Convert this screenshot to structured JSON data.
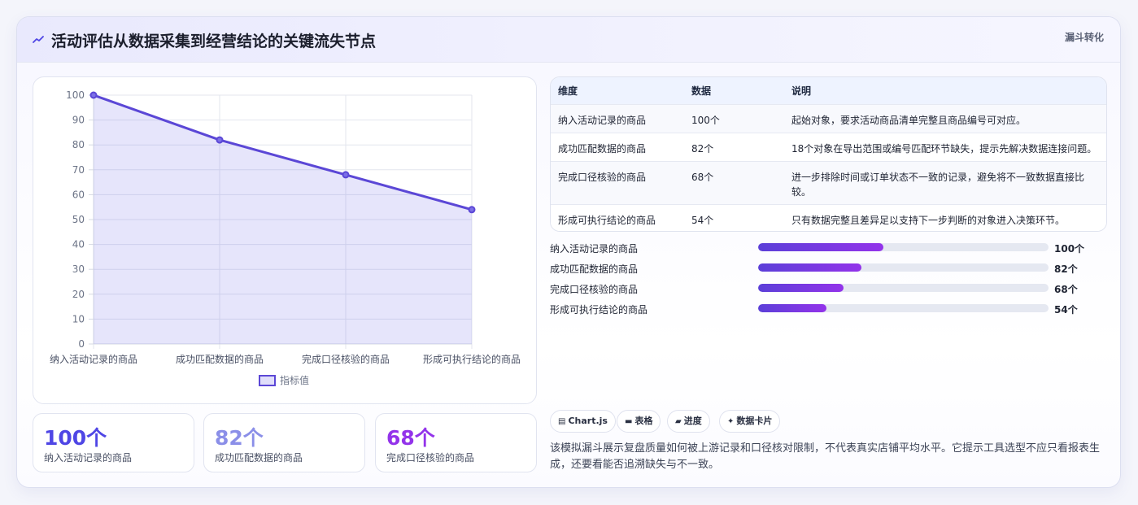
{
  "header": {
    "icon": "chart-trend-icon",
    "title": "活动评估从数据采集到经营结论的关键流失节点",
    "tag": "漏斗转化"
  },
  "colors": {
    "accent": "#5b47d6",
    "stat1": "#4f46e5",
    "stat2": "#8b8fe8",
    "stat3": "#9333ea"
  },
  "chart_data": {
    "type": "area",
    "categories": [
      "纳入活动记录的商品",
      "成功匹配数据的商品",
      "完成口径核验的商品",
      "形成可执行结论的商品"
    ],
    "series": [
      {
        "name": "指标值",
        "values": [
          100,
          82,
          68,
          54
        ]
      }
    ],
    "ylim": [
      0,
      100
    ],
    "yticks": [
      0,
      10,
      20,
      30,
      40,
      50,
      60,
      70,
      80,
      90,
      100
    ],
    "grid": true,
    "legend": "bottom"
  },
  "stats": [
    {
      "value": "100个",
      "label": "纳入活动记录的商品"
    },
    {
      "value": "82个",
      "label": "成功匹配数据的商品"
    },
    {
      "value": "68个",
      "label": "完成口径核验的商品"
    }
  ],
  "table": {
    "headers": [
      "维度",
      "数据",
      "说明"
    ],
    "rows": [
      [
        "纳入活动记录的商品",
        "100个",
        "起始对象，要求活动商品清单完整且商品编号可对应。"
      ],
      [
        "成功匹配数据的商品",
        "82个",
        "18个对象在导出范围或编号匹配环节缺失，提示先解决数据连接问题。"
      ],
      [
        "完成口径核验的商品",
        "68个",
        "进一步排除时间或订单状态不一致的记录，避免将不一致数据直接比较。"
      ],
      [
        "形成可执行结论的商品",
        "54个",
        "只有数据完整且差异足以支持下一步判断的对象进入决策环节。"
      ]
    ]
  },
  "progress": [
    {
      "label": "纳入活动记录的商品",
      "value": "100个",
      "fraction": 0.43
    },
    {
      "label": "成功匹配数据的商品",
      "value": "82个",
      "fraction": 0.355
    },
    {
      "label": "完成口径核验的商品",
      "value": "68个",
      "fraction": 0.295
    },
    {
      "label": "形成可执行结论的商品",
      "value": "54个",
      "fraction": 0.235
    }
  ],
  "chips": [
    {
      "icon": "chart-icon",
      "glyph": "▤",
      "label": "Chart.js"
    },
    {
      "icon": "table-icon",
      "glyph": "▬",
      "label": "表格"
    },
    {
      "icon": "progress-icon",
      "glyph": "▰",
      "label": "进度"
    },
    {
      "icon": "sparkle-icon",
      "glyph": "✦",
      "label": "数据卡片"
    }
  ],
  "note": "该模拟漏斗展示复盘质量如何被上游记录和口径核对限制，不代表真实店铺平均水平。它提示工具选型不应只看报表生成，还要看能否追溯缺失与不一致。"
}
